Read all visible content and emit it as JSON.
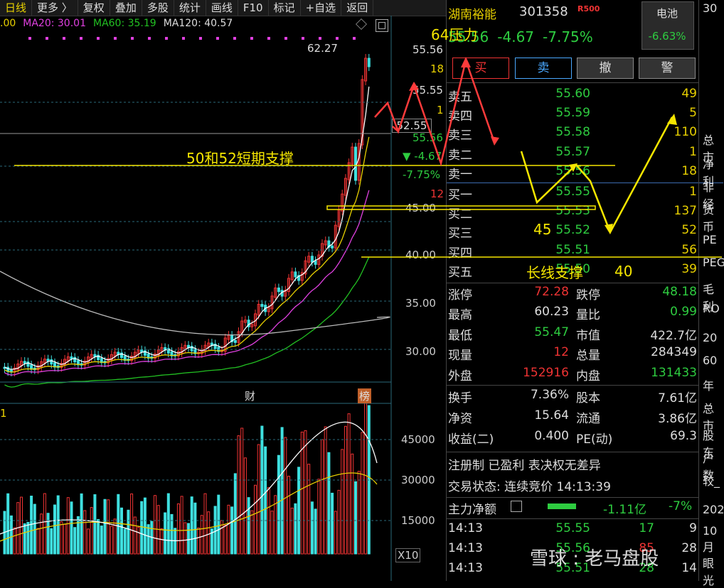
{
  "toolbar": [
    "日线",
    "更多 〉",
    "复权",
    "叠加",
    "多股",
    "统计",
    "画线",
    "F10",
    "标记",
    "+自选",
    "返回"
  ],
  "ma": {
    "ma10": ".00",
    "ma20": "MA20: 30.01",
    "ma60": "MA60: 35.19",
    "ma120": "MA120: 40.57"
  },
  "stock": {
    "name": "湖南裕能",
    "code": "301358",
    "badge": "R500",
    "price": "55.56",
    "change": "-4.67",
    "pct": "-7.75%",
    "sector": "电池",
    "sector_pct": "-6.63%"
  },
  "buttons": {
    "buy": "买",
    "sell": "卖",
    "cancel": "撤",
    "alert": "警"
  },
  "orderbook": [
    {
      "label": "卖五",
      "price": "55.60",
      "vol": "49"
    },
    {
      "label": "卖四",
      "price": "55.59",
      "vol": "5"
    },
    {
      "label": "卖三",
      "price": "55.58",
      "vol": "110"
    },
    {
      "label": "卖二",
      "price": "55.57",
      "vol": "1"
    },
    {
      "label": "卖一",
      "price": "55.56",
      "vol": "18"
    },
    {
      "label": "买一",
      "price": "55.55",
      "vol": "1"
    },
    {
      "label": "买二",
      "price": "55.53",
      "vol": "137"
    },
    {
      "label": "买三",
      "price": "55.52",
      "vol": "52"
    },
    {
      "label": "买四",
      "price": "55.51",
      "vol": "56"
    },
    {
      "label": "买五",
      "price": "55.50",
      "vol": "39"
    }
  ],
  "stats": {
    "zt_l": "涨停",
    "zt_v": "72.28",
    "dt_l": "跌停",
    "dt_v": "48.18",
    "zg_l": "最高",
    "zg_v": "60.23",
    "lb_l": "量比",
    "lb_v": "0.99",
    "zd_l": "最低",
    "zd_v": "55.47",
    "sz_l": "市值",
    "sz_v": "422.7亿",
    "xl_l": "现量",
    "xl_v": "12",
    "zl_l": "总量",
    "zl_v": "284349",
    "wp_l": "外盘",
    "wp_v": "152916",
    "np_l": "内盘",
    "np_v": "131433",
    "hs_l": "换手",
    "hs_v": "7.36%",
    "gb_l": "股本",
    "gb_v": "7.61亿",
    "jz_l": "净资",
    "jz_v": "15.64",
    "lt_l": "流通",
    "lt_v": "3.86亿",
    "sy_l": "收益(二)",
    "sy_v": "0.400",
    "pe_l": "PE(动)",
    "pe_v": "69.3"
  },
  "info": {
    "tags": "注册制 已盈利 表决权无差异",
    "status": "交易状态: 连续竞价 14:13:39",
    "flow_l": "主力净额",
    "flow_v": "-1.11亿",
    "flow_p": "-7%"
  },
  "ticks": [
    {
      "t": "14:13",
      "p": "55.55",
      "v": "17",
      "n": "9"
    },
    {
      "t": "14:13",
      "p": "55.56",
      "v": "85",
      "n": "28"
    },
    {
      "t": "14:13",
      "p": "55.51",
      "v": "28",
      "n": "14"
    }
  ],
  "axis": {
    "p1": "55.56",
    "p2": "18",
    "p3": "55.55",
    "p4": "1",
    "p5": "52.55",
    "p6": "55.56",
    "p7": "▼ -4.67",
    "p8": "-7.75%",
    "p9": "12",
    "p10": "45.00",
    "p11": "40.00",
    "p12": "35.00",
    "p13": "30.00",
    "peak": "62.27",
    "v1": "45000",
    "v2": "30000",
    "v3": "15000",
    "x10": "X10",
    "cai": "财",
    "bang": "榜",
    "vol_lab": "1"
  },
  "annotations": {
    "a64": "64压力",
    "a5052": "50和52短期支撑",
    "a45": "45",
    "along": "长线支撑",
    "a40": "40"
  },
  "far": [
    "30",
    "总市",
    "净利",
    "非经",
    "货币",
    "PE",
    "PEG",
    "毛利",
    "RO",
    "20",
    "60",
    "年",
    "总市",
    "股东",
    "户数",
    "较_",
    "202",
    "10月",
    "眼光"
  ],
  "watermark": "雪球 : 老马盘股",
  "colors": {
    "up": "#e33",
    "down": "#2ecc40",
    "text": "#ddd",
    "accent": "#e8d000",
    "ma20": "#e040e0",
    "ma60": "#22c022",
    "ma120": "#bbbbbb"
  }
}
